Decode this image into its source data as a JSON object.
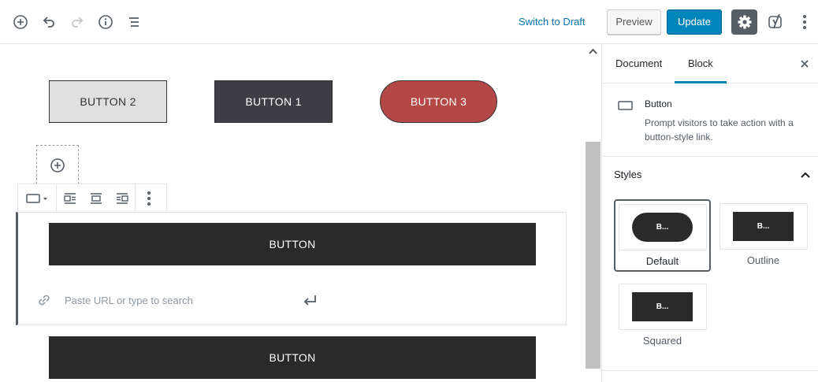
{
  "topbar": {
    "switch_to_draft": "Switch to Draft",
    "preview": "Preview",
    "update": "Update",
    "icons": [
      "add-block-icon",
      "undo-icon",
      "redo-icon",
      "info-icon",
      "outline-icon",
      "gear-icon",
      "yoast-icon",
      "more-options-icon"
    ],
    "accent_color": "#0085ba",
    "link_color": "#0073aa"
  },
  "editor": {
    "buttons_row": [
      {
        "label": "BUTTON 2",
        "bg": "#e0e0e0"
      },
      {
        "label": "BUTTON 1",
        "bg": "#3d3d43"
      },
      {
        "label": "BUTTON 3",
        "bg": "#b34846"
      }
    ],
    "selected_button_label": "BUTTON",
    "url_placeholder": "Paste URL or type to search",
    "lower_button_label": "BUTTON"
  },
  "sidebar": {
    "tab_document": "Document",
    "tab_block": "Block",
    "block_title": "Button",
    "block_description": "Prompt visitors to take action with a button-style link.",
    "styles_heading": "Styles",
    "styles": [
      {
        "label": "Default",
        "preview": "B...",
        "active": true
      },
      {
        "label": "Outline",
        "preview": "B...",
        "active": false
      },
      {
        "label": "Squared",
        "preview": "B...",
        "active": false
      }
    ]
  }
}
